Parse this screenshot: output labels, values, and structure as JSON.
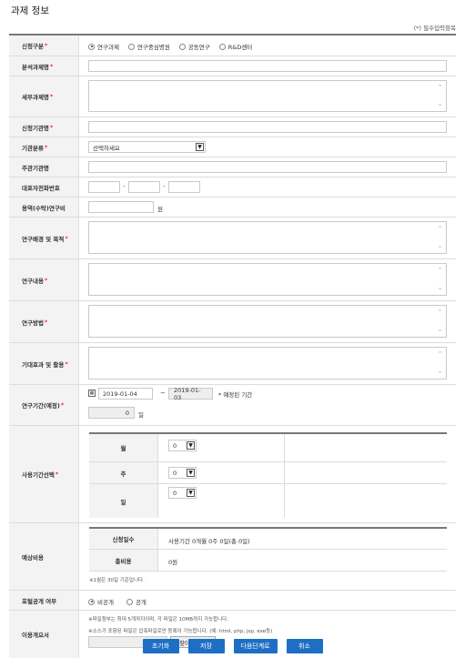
{
  "page": {
    "title": "과제 정보",
    "required_note": "(*) 필수입력항목"
  },
  "fields": {
    "apply_type": {
      "label": "신청구분",
      "options": [
        "연구과제",
        "연구중심병원",
        "공동연구",
        "R&D센터"
      ],
      "selected_index": 0
    },
    "analysis_title": {
      "label": "분석과제명",
      "value": ""
    },
    "detail_title": {
      "label": "세부과제명",
      "value": ""
    },
    "institution": {
      "label": "신청기관명",
      "value": ""
    },
    "inst_type": {
      "label": "기관분류",
      "selected": "선택하세요"
    },
    "host_inst": {
      "label": "주관기관명",
      "value": ""
    },
    "phone": {
      "label": "대표자전화번호",
      "parts": [
        "",
        "",
        ""
      ],
      "sep": "-"
    },
    "budget": {
      "label": "용역(수탁)연구비",
      "value": "",
      "unit": "원"
    },
    "background": {
      "label": "연구배경 및 목적"
    },
    "content": {
      "label": "연구내용"
    },
    "method": {
      "label": "연구방법"
    },
    "effect": {
      "label": "기대효과 및 활용"
    },
    "period": {
      "label": "연구기간(예정)",
      "start": "2019-01-04",
      "tilde": "~",
      "end": "2019-01-03",
      "note": "* 예정된 기간",
      "days": "0",
      "days_unit": "일"
    },
    "usage": {
      "label": "사용기간선택",
      "rows": [
        {
          "unit": "월",
          "value": "0"
        },
        {
          "unit": "주",
          "value": "0"
        },
        {
          "unit": "일",
          "value": "0"
        }
      ]
    },
    "estimate": {
      "label": "예상비용",
      "rows": [
        {
          "label": "신청일수",
          "value": "사용기간 0개월 0주 0일(총 0일)"
        },
        {
          "label": "총비용",
          "value": "0원"
        }
      ],
      "note": "※1월은 30일 기준입니다."
    },
    "portal": {
      "label": "포털공개 여부",
      "options": [
        "비공개",
        "공개"
      ],
      "selected_index": 0
    },
    "request": {
      "label": "이용개요서",
      "note1": "※파일첨부는 최대 5개까지이며, 각 파일은 10MB까지 가능합니다.",
      "note2": "※소스가 포함된 파일은 압축파일로만 등록이 가능합니다. (예: html, php, jsp, exe등)",
      "browse": "찾아보기..."
    }
  },
  "actions": {
    "reset": "초기화",
    "save": "저장",
    "next": "다음단계로",
    "cancel": "취소"
  },
  "colors": {
    "primary_button": "#1e6fc4",
    "required_star": "#e33333"
  }
}
